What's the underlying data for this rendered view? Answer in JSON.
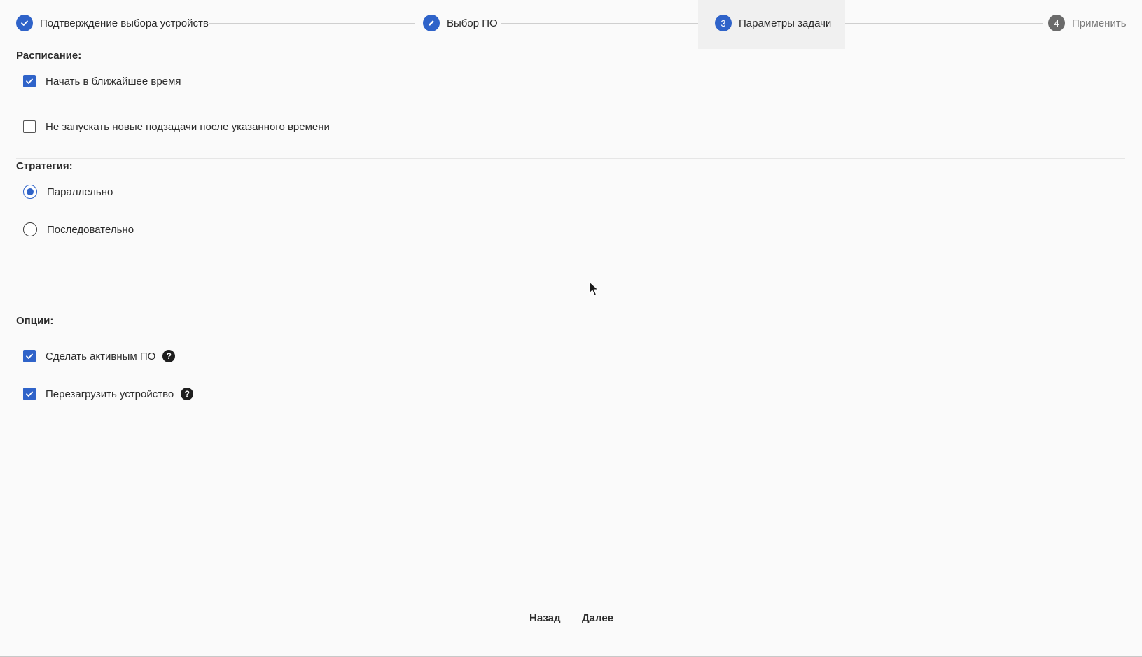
{
  "stepper": {
    "steps": [
      {
        "label": "Подтверждение выбора устройств",
        "state": "completed",
        "icon": "check-icon"
      },
      {
        "label": "Выбор ПО",
        "state": "edited",
        "icon": "pencil-icon"
      },
      {
        "label": "Параметры задачи",
        "state": "active",
        "number": "3"
      },
      {
        "label": "Применить",
        "state": "pending",
        "number": "4"
      }
    ]
  },
  "schedule": {
    "title": "Расписание:",
    "start_soon_label": "Начать в ближайшее время",
    "start_soon_checked": true,
    "no_new_subtasks_label": "Не запускать новые подзадачи после указанного времени",
    "no_new_subtasks_checked": false
  },
  "strategy": {
    "title": "Стратегия:",
    "parallel_label": "Параллельно",
    "sequential_label": "Последовательно",
    "selected": "parallel"
  },
  "options": {
    "title": "Опции:",
    "make_active_label": "Сделать активным ПО",
    "make_active_checked": true,
    "reboot_label": "Перезагрузить устройство",
    "reboot_checked": true,
    "help_glyph": "?"
  },
  "footer": {
    "back_label": "Назад",
    "next_label": "Далее"
  },
  "colors": {
    "accent": "#2f63c9",
    "pending": "#6b6b6b"
  }
}
